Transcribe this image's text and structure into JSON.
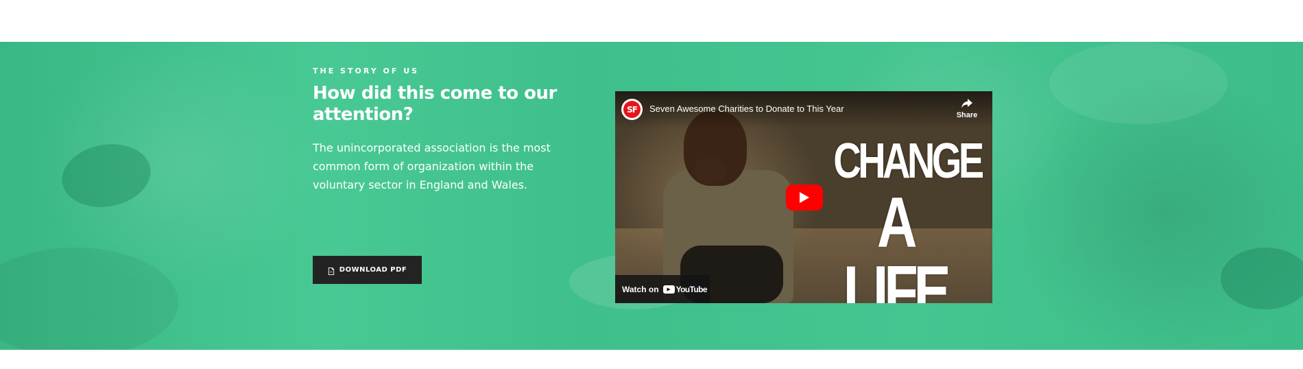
{
  "section": {
    "eyebrow": "THE STORY OF US",
    "heading": "How did this come to our attention?",
    "body": "The unincorporated association is the most common form of organization within the voluntary sector in England and Wales.",
    "download_label": "DOWNLOAD PDF",
    "download_icon": "pdf-file-icon",
    "accent_color": "#45c590",
    "button_color": "#232323"
  },
  "video": {
    "channel_logo_text": "SF",
    "title": "Seven Awesome Charities to Donate to This Year",
    "share_label": "Share",
    "thumbnail_text_line1": "CHANGE",
    "thumbnail_text_line2": "A LIFE",
    "watch_on_label": "Watch on",
    "platform_name": "YouTube",
    "play_button_color": "#ff0000"
  }
}
